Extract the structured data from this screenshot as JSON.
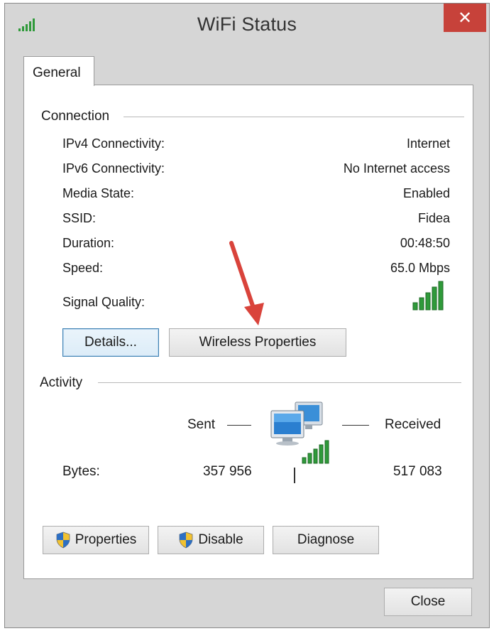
{
  "window": {
    "title": "WiFi Status",
    "close_glyph": "✕",
    "title_icon": "signal-bars-icon"
  },
  "tabs": [
    {
      "label": "General",
      "selected": true
    }
  ],
  "connection": {
    "group_title": "Connection",
    "rows": [
      {
        "label": "IPv4 Connectivity:",
        "value": "Internet"
      },
      {
        "label": "IPv6 Connectivity:",
        "value": "No Internet access"
      },
      {
        "label": "Media State:",
        "value": "Enabled"
      },
      {
        "label": "SSID:",
        "value": "Fidea"
      },
      {
        "label": "Duration:",
        "value": "00:48:50"
      },
      {
        "label": "Speed:",
        "value": "65.0 Mbps"
      }
    ],
    "signal_label": "Signal Quality:",
    "signal_bars_lit": 5,
    "signal_bars_total": 5,
    "details_button": "Details...",
    "wireless_properties_button": "Wireless Properties"
  },
  "activity": {
    "group_title": "Activity",
    "sent_label": "Sent",
    "received_label": "Received",
    "bytes_label": "Bytes:",
    "bytes_sent": "357 956",
    "bytes_received": "517 083"
  },
  "buttons": {
    "properties": "Properties",
    "disable": "Disable",
    "diagnose": "Diagnose",
    "close": "Close"
  },
  "colors": {
    "close_button": "#c7423a",
    "signal_green": "#2f9a3a",
    "arrow_red": "#d9433b"
  }
}
